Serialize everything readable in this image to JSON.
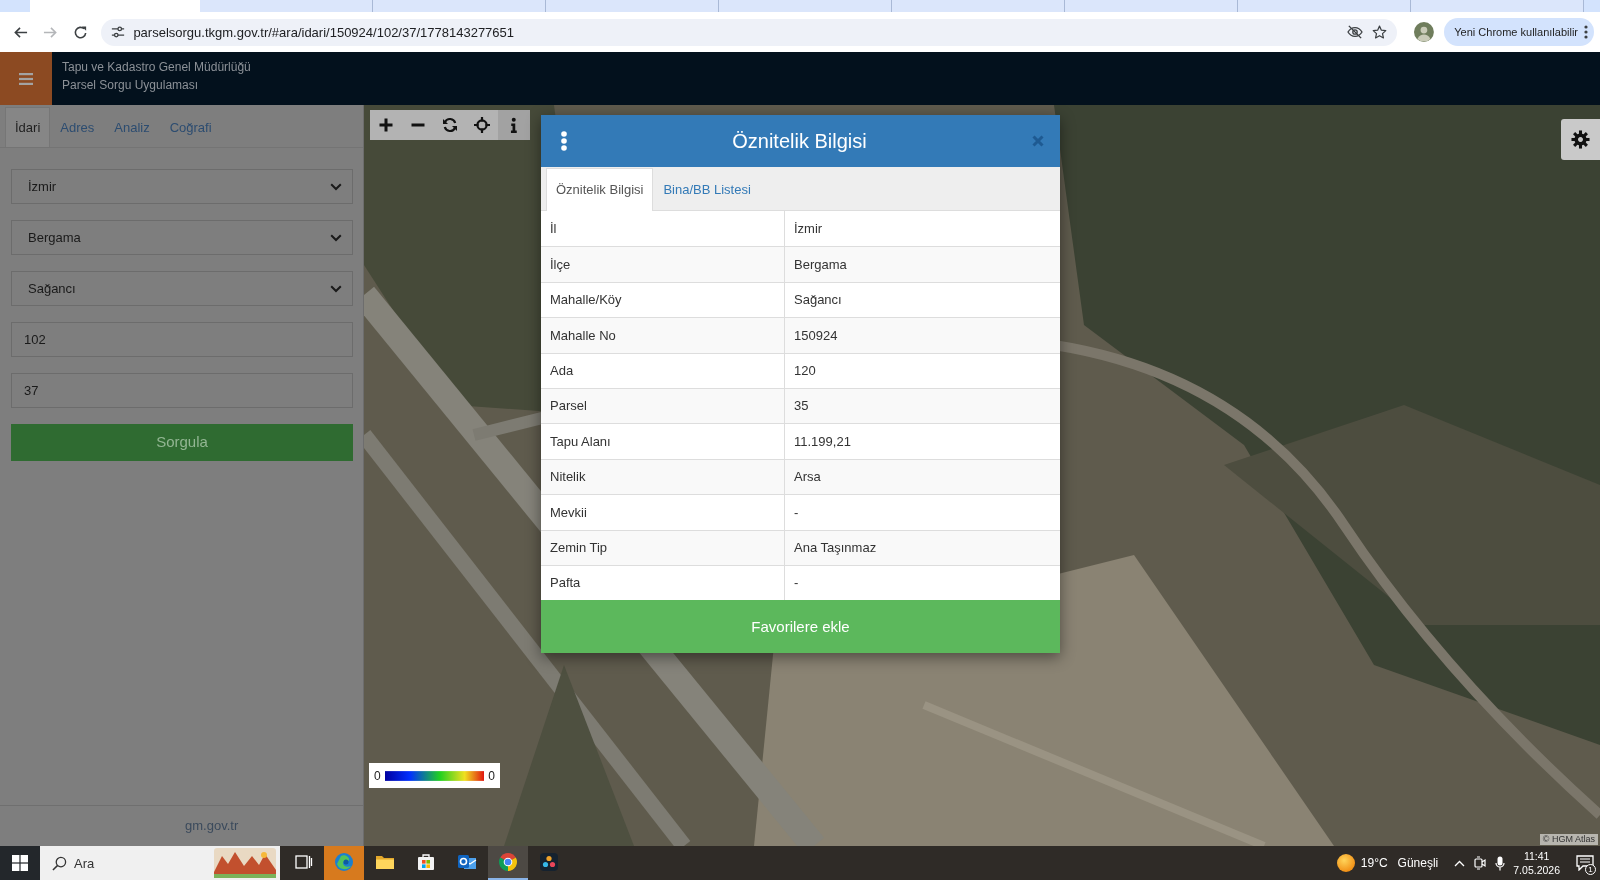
{
  "browser": {
    "tabs": [
      {
        "selected": true
      },
      {
        "selected": false
      },
      {
        "selected": false
      },
      {
        "selected": false
      },
      {
        "selected": false
      },
      {
        "selected": false
      },
      {
        "selected": false
      },
      {
        "selected": false
      },
      {
        "selected": false
      }
    ],
    "nav": [
      {
        "kind": "back",
        "disabled": false
      },
      {
        "kind": "forward",
        "disabled": true
      },
      {
        "kind": "reload",
        "disabled": false
      }
    ],
    "address": "parselsorgu.tkgm.gov.tr/#ara/idari/150924/102/37/1778143277651",
    "update_button": "Yeni Chrome kullanılabilir"
  },
  "app_header": {
    "title": "Tapu ve Kadastro Genel Müdürlüğü",
    "subtitle": "Parsel Sorgu Uygulaması"
  },
  "sidebar": {
    "tabs": [
      {
        "label": "İdari",
        "selected": true
      },
      {
        "label": "Adres",
        "selected": false
      },
      {
        "label": "Analiz",
        "selected": false
      },
      {
        "label": "Coğrafi",
        "selected": false
      }
    ],
    "fields": [
      {
        "kind": "select",
        "value": "İzmir"
      },
      {
        "kind": "select",
        "value": "Bergama"
      },
      {
        "kind": "select",
        "value": "Sağancı"
      },
      {
        "kind": "input",
        "value": "102"
      },
      {
        "kind": "input",
        "value": "37"
      }
    ],
    "query_button": "Sorgula",
    "footer": "gm.gov.tr"
  },
  "map": {
    "tools": [
      {
        "kind": "plus",
        "selected": false
      },
      {
        "kind": "minus",
        "selected": false
      },
      {
        "kind": "refresh",
        "selected": false
      },
      {
        "kind": "locate",
        "selected": false
      },
      {
        "kind": "info",
        "selected": true
      }
    ],
    "legend": {
      "min": "0",
      "max": "0"
    },
    "attribution": "© HGM Atlas"
  },
  "dialog": {
    "title": "Öznitelik Bilgisi",
    "tabs": [
      {
        "label": "Öznitelik Bilgisi",
        "selected": true
      },
      {
        "label": "Bina/BB Listesi",
        "selected": false
      }
    ],
    "rows": [
      {
        "label": "İl",
        "value": "İzmir"
      },
      {
        "label": "İlçe",
        "value": "Bergama"
      },
      {
        "label": "Mahalle/Köy",
        "value": "Sağancı"
      },
      {
        "label": "Mahalle No",
        "value": "150924"
      },
      {
        "label": "Ada",
        "value": "120"
      },
      {
        "label": "Parsel",
        "value": "35"
      },
      {
        "label": "Tapu Alanı",
        "value": "11.199,21"
      },
      {
        "label": "Nitelik",
        "value": "Arsa"
      },
      {
        "label": "Mevkii",
        "value": "-"
      },
      {
        "label": "Zemin Tip",
        "value": "Ana Taşınmaz"
      },
      {
        "label": "Pafta",
        "value": "-"
      }
    ],
    "button": "Favorilere ekle"
  },
  "taskbar": {
    "search_placeholder": "Ara",
    "apps": [
      {
        "kind": "task-view",
        "active": false,
        "attention": false
      },
      {
        "kind": "edge",
        "active": false,
        "attention": true
      },
      {
        "kind": "folder",
        "active": false,
        "attention": false
      },
      {
        "kind": "store",
        "active": false,
        "attention": false
      },
      {
        "kind": "mail",
        "active": false,
        "attention": false
      },
      {
        "kind": "chrome",
        "active": true,
        "attention": false
      },
      {
        "kind": "resolve",
        "active": false,
        "attention": false
      }
    ],
    "weather": {
      "temperature": "19°C",
      "condition": "Güneşli"
    },
    "time": "11:41",
    "date": "7.05.2026",
    "notifications": "1"
  }
}
